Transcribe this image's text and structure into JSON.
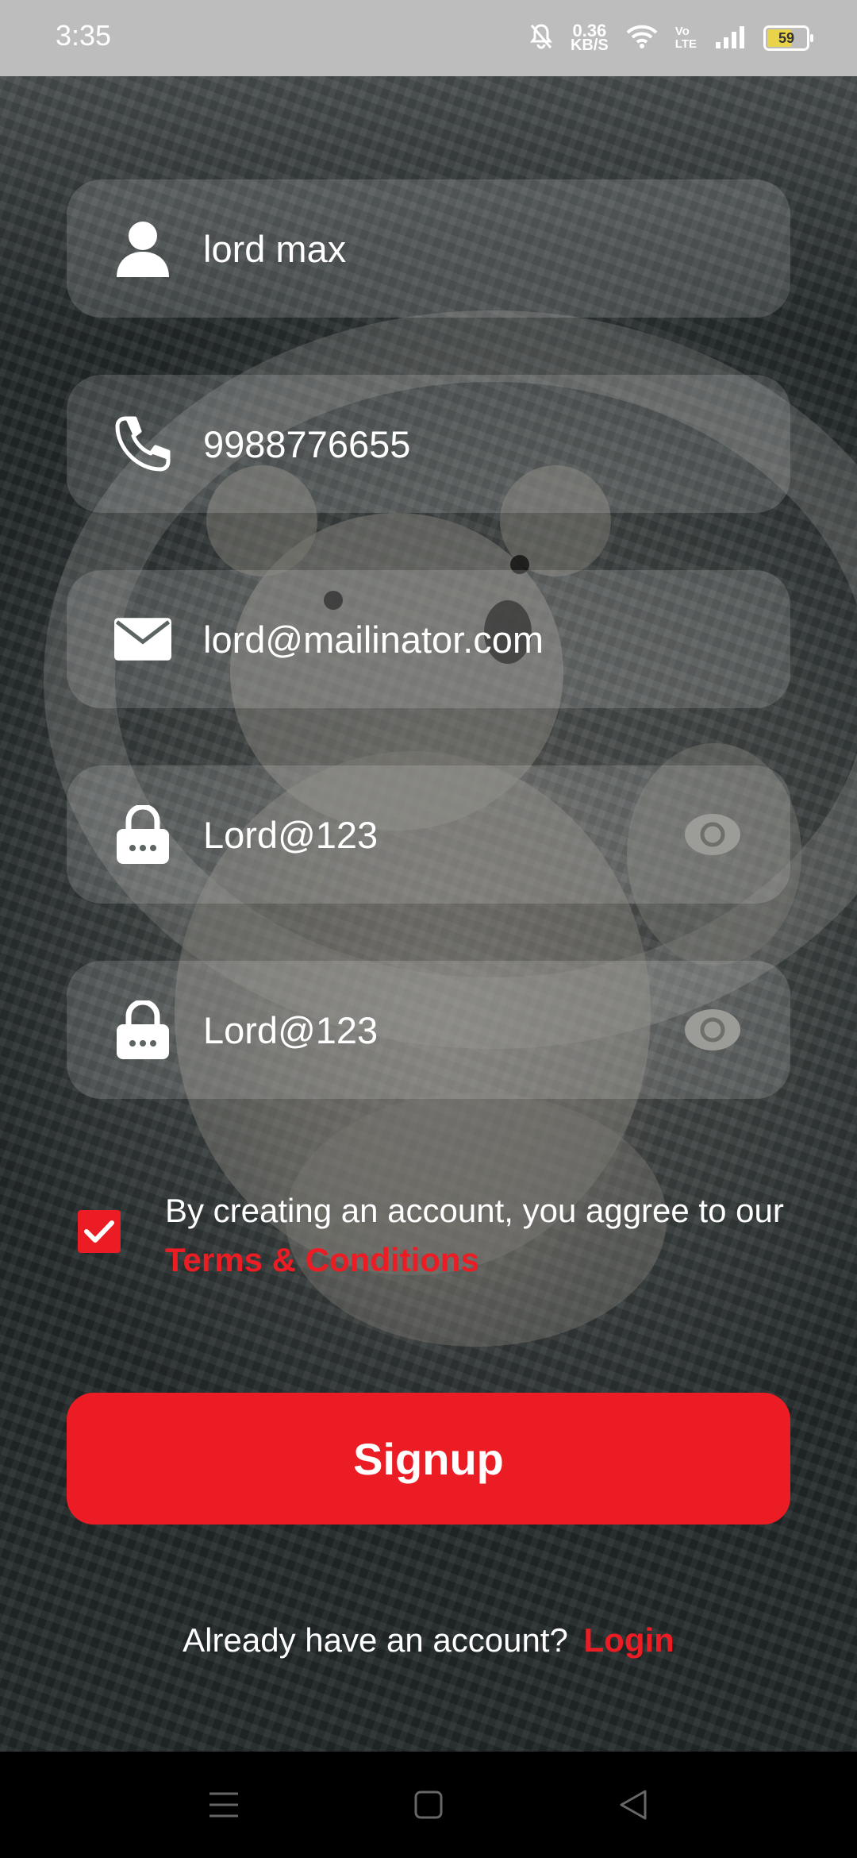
{
  "status_bar": {
    "time": "3:35",
    "speed_value": "0.36",
    "speed_unit": "KB/S",
    "volte_top": "Vo",
    "volte_bottom": "LTE",
    "battery": "59",
    "icons": [
      "bell-off-icon",
      "wifi-icon",
      "signal-icon",
      "battery-icon"
    ]
  },
  "form": {
    "name": {
      "value": "lord max",
      "icon": "person-icon"
    },
    "phone": {
      "value": "9988776655",
      "icon": "phone-icon"
    },
    "email": {
      "value": "lord@mailinator.com",
      "icon": "mail-icon"
    },
    "password": {
      "value": "Lord@123",
      "icon": "lock-icon",
      "toggle_icon": "eye-icon"
    },
    "confirm_password": {
      "value": "Lord@123",
      "icon": "lock-icon",
      "toggle_icon": "eye-icon"
    }
  },
  "terms": {
    "checked": true,
    "text": "By creating an account, you aggree to our ",
    "link": "Terms & Conditions"
  },
  "signup_label": "Signup",
  "login_prompt": {
    "text": "Already have an account?",
    "link": "Login"
  },
  "colors": {
    "accent": "#ec1c24",
    "field_bg": "rgba(255,255,255,0.15)",
    "status_bar": "#bdbdbd",
    "nav_bar": "#000000"
  },
  "nav_bar": [
    "menu-icon",
    "home-icon",
    "back-icon"
  ]
}
